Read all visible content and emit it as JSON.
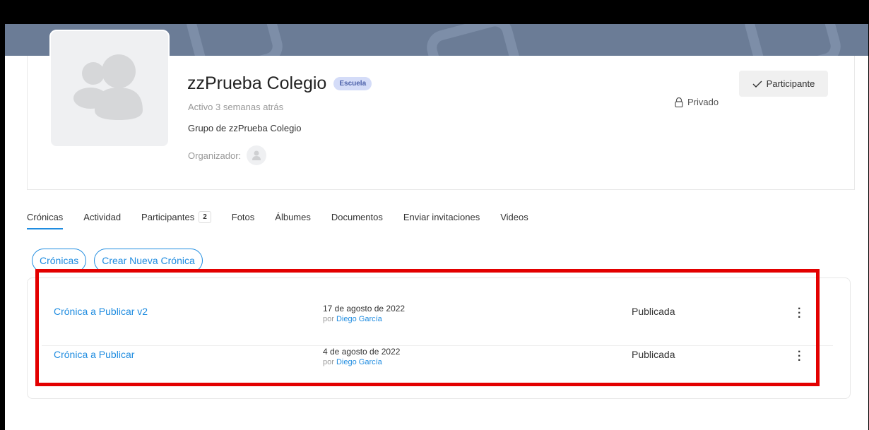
{
  "group": {
    "name": "zzPrueba Colegio",
    "badge": "Escuela",
    "activity": "Activo 3 semanas atrás",
    "description": "Grupo de zzPrueba Colegio",
    "organizer_label": "Organizador:",
    "privacy": "Privado",
    "participant_button": "Participante"
  },
  "tabs": [
    {
      "label": "Crónicas"
    },
    {
      "label": "Actividad"
    },
    {
      "label": "Participantes",
      "count": "2"
    },
    {
      "label": "Fotos"
    },
    {
      "label": "Álbumes"
    },
    {
      "label": "Documentos"
    },
    {
      "label": "Enviar invitaciones"
    },
    {
      "label": "Videos"
    }
  ],
  "subnav": {
    "cronicas": "Crónicas",
    "create": "Crear Nueva Crónica"
  },
  "posts": [
    {
      "title": "Crónica a Publicar v2",
      "date": "17 de agosto de 2022",
      "by": "por",
      "author": "Diego García",
      "status": "Publicada"
    },
    {
      "title": "Crónica a Publicar",
      "date": "4 de agosto de 2022",
      "by": "por",
      "author": "Diego García",
      "status": "Publicada"
    }
  ],
  "colors": {
    "accent": "#1f8ce0",
    "highlight": "#e30000",
    "cover": "#6b7c96"
  }
}
